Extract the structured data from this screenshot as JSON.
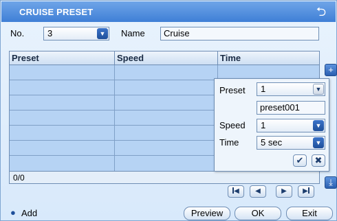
{
  "window": {
    "title": "CRUISE PRESET",
    "back_icon": "back-arrow-icon"
  },
  "form": {
    "no_label": "No.",
    "no_value": "3",
    "name_label": "Name",
    "name_value": "Cruise"
  },
  "table": {
    "columns": [
      "Preset",
      "Speed",
      "Time"
    ],
    "rows": [],
    "count": "0/0"
  },
  "popup": {
    "preset_label": "Preset",
    "preset_value": "1",
    "preset_name": "preset001",
    "speed_label": "Speed",
    "speed_value": "1",
    "time_label": "Time",
    "time_value": "5 sec",
    "confirm_icon": "checkmark-icon",
    "cancel_icon": "close-icon"
  },
  "side": {
    "add_icon": "plus-icon",
    "down_icon": "download-icon"
  },
  "pager": [
    "first-page-icon",
    "prev-page-icon",
    "next-page-icon",
    "last-page-icon"
  ],
  "footer": {
    "add_label": "Add",
    "preview_label": "Preview",
    "ok_label": "OK",
    "exit_label": "Exit"
  },
  "colors": {
    "title_bar": "#3f7fd6",
    "grid_fill": "#b6d3f4",
    "button_blue": "#2a5fb0"
  }
}
